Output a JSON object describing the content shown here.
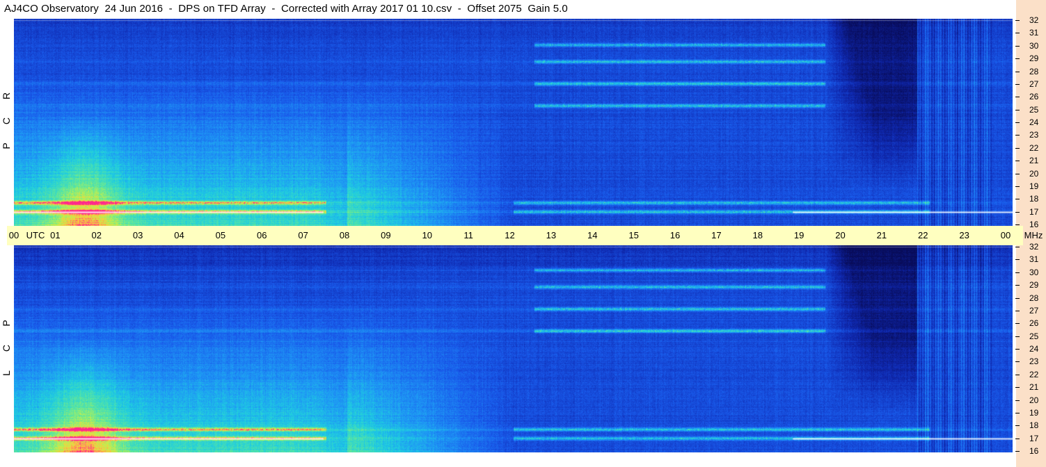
{
  "header": {
    "title": "AJ4CO Observatory  24 Jun 2016  -  DPS on TFD Array  -  Corrected with Array 2017 01 10.csv  -  Offset 2075  Gain 5.0"
  },
  "panels": {
    "rcp_label": [
      "R",
      "C",
      "P"
    ],
    "lcp_label": [
      "L",
      "C",
      "P"
    ]
  },
  "colors": {
    "axis_band": "#ffffc0",
    "side_strip": "#fbe0c8",
    "deep_blue": "#0a1a8a",
    "mid_blue": "#1a55e0",
    "cyan": "#20c8e8",
    "green_yellow": "#c8f050",
    "hot": "#ff2080"
  },
  "chart_data": {
    "type": "heatmap",
    "title": "AJ4CO Observatory  24 Jun 2016  -  DPS on TFD Array  -  Corrected with Array 2017 01 10.csv  -  Offset 2075  Gain 5.0",
    "x_axis": {
      "range": [
        0,
        24
      ],
      "ticks": [
        "00",
        "01",
        "02",
        "03",
        "04",
        "05",
        "06",
        "07",
        "08",
        "09",
        "10",
        "11",
        "12",
        "13",
        "14",
        "15",
        "16",
        "17",
        "18",
        "19",
        "20",
        "21",
        "22",
        "23",
        "00"
      ],
      "start_label": "UTC",
      "end_unit": "MHz"
    },
    "y_axis": {
      "range": [
        16,
        32
      ],
      "ticks": [
        16,
        17,
        18,
        19,
        20,
        21,
        22,
        23,
        24,
        25,
        26,
        27,
        28,
        29,
        30,
        31,
        32
      ]
    },
    "panels": [
      {
        "polarization": "RCP",
        "bright_bands_mhz": [
          17.1,
          17.8,
          25.3,
          27.0,
          28.7,
          30.0
        ]
      },
      {
        "polarization": "LCP",
        "bright_bands_mhz": [
          17.1,
          17.8,
          25.4,
          27.1,
          28.8,
          30.1
        ]
      }
    ],
    "features": {
      "daytime_enhancement_hours_utc": [
        0,
        9
      ],
      "night_quiet_hours_utc": [
        19.5,
        21.7
      ],
      "vertical_interference_hours_utc": [
        21.7,
        23.5
      ]
    }
  }
}
